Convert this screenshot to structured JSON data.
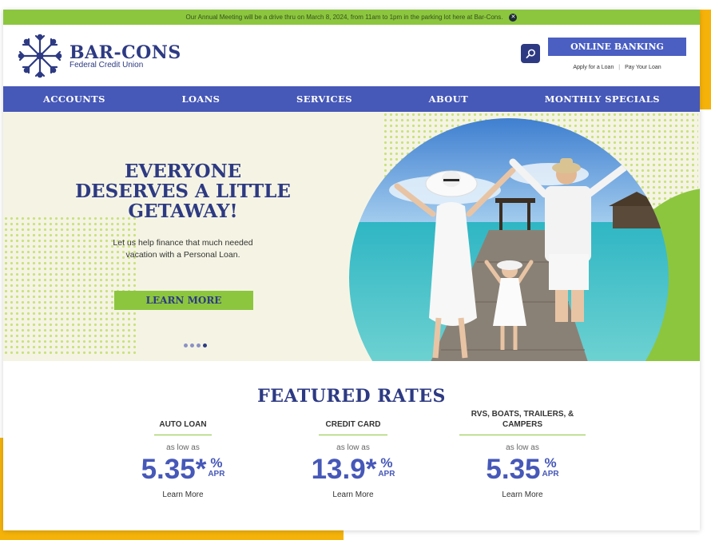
{
  "announcement": {
    "text": "Our Annual Meeting will be a drive thru on March 8, 2024, from 11am to 1pm in the parking lot here at Bar-Cons.",
    "close_glyph": "✕"
  },
  "brand": {
    "name": "BAR-CONS",
    "subtitle": "Federal Credit Union"
  },
  "header": {
    "online_banking_label": "ONLINE BANKING",
    "apply_link": "Apply for a Loan",
    "pay_link": "Pay Your Loan",
    "link_separator": "|"
  },
  "nav": {
    "items": [
      {
        "label": "ACCOUNTS"
      },
      {
        "label": "LOANS"
      },
      {
        "label": "SERVICES"
      },
      {
        "label": "ABOUT"
      },
      {
        "label": "MONTHLY SPECIALS"
      }
    ]
  },
  "hero": {
    "headline": "EVERYONE\nDESERVES A LITTLE\nGETAWAY!",
    "subtext": "Let us help finance that much needed\nvacation with a Personal Loan.",
    "button_label": "LEARN MORE",
    "carousel": {
      "count": 4,
      "active": 4
    }
  },
  "rates": {
    "title": "FEATURED RATES",
    "items": [
      {
        "label": "AUTO LOAN",
        "as_low_as": "as low as",
        "value": "5.35",
        "star": "*",
        "pct": "%",
        "apr": "APR",
        "more": "Learn More"
      },
      {
        "label": "CREDIT CARD",
        "as_low_as": "as low as",
        "value": "13.9",
        "star": "*",
        "pct": "%",
        "apr": "APR",
        "more": "Learn More"
      },
      {
        "label": "RVS, BOATS, TRAILERS, & CAMPERS",
        "as_low_as": "as low as",
        "value": "5.35",
        "star": "",
        "pct": "%",
        "apr": "APR",
        "more": "Learn More"
      }
    ]
  },
  "colors": {
    "navy": "#2d3a83",
    "nav_blue": "#4658b8",
    "lime": "#8cc63f",
    "gold": "#f5b30a",
    "cream": "#f5f4e4"
  },
  "icons": [
    "logo-icon",
    "search-icon",
    "close-icon"
  ]
}
